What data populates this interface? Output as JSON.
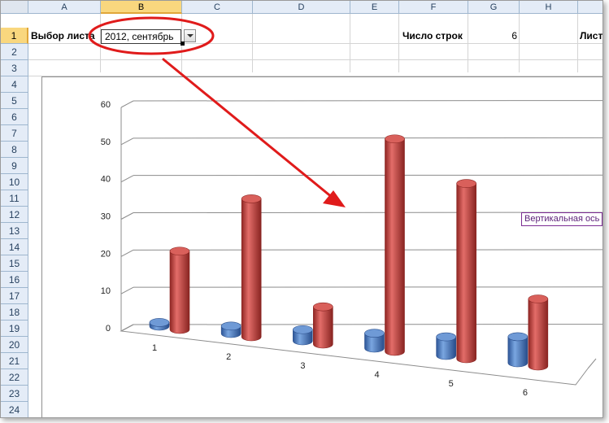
{
  "grid": {
    "columns": [
      "A",
      "B",
      "C",
      "D",
      "E",
      "F",
      "G",
      "H",
      ""
    ],
    "active_column": "B",
    "rows": [
      "1",
      "2",
      "3",
      "4",
      "5",
      "6",
      "7",
      "8",
      "9",
      "10",
      "11",
      "12",
      "13",
      "14",
      "15",
      "16",
      "17",
      "18",
      "19",
      "20",
      "21",
      "22",
      "23",
      "24"
    ],
    "active_row": "1"
  },
  "cells": {
    "a1": "Выбор листа",
    "b1": "2012, сентябрь",
    "f1": "Число строк",
    "g1": "6",
    "i1": "Лист"
  },
  "chart_data": {
    "type": "bar",
    "categories": [
      "1",
      "2",
      "3",
      "4",
      "5",
      "6"
    ],
    "series": [
      {
        "values": [
          1,
          2,
          3,
          4,
          5,
          7
        ],
        "color": "#4f81bd"
      },
      {
        "values": [
          21,
          37,
          10,
          57,
          47,
          18
        ],
        "color": "#c0504d"
      }
    ],
    "y_ticks": [
      "0",
      "10",
      "20",
      "30",
      "40",
      "50",
      "60"
    ],
    "ylim": [
      0,
      60
    ],
    "grid": true,
    "tooltip": "Вертикальная ось"
  },
  "annotation": {
    "color": "#e01b1b"
  }
}
